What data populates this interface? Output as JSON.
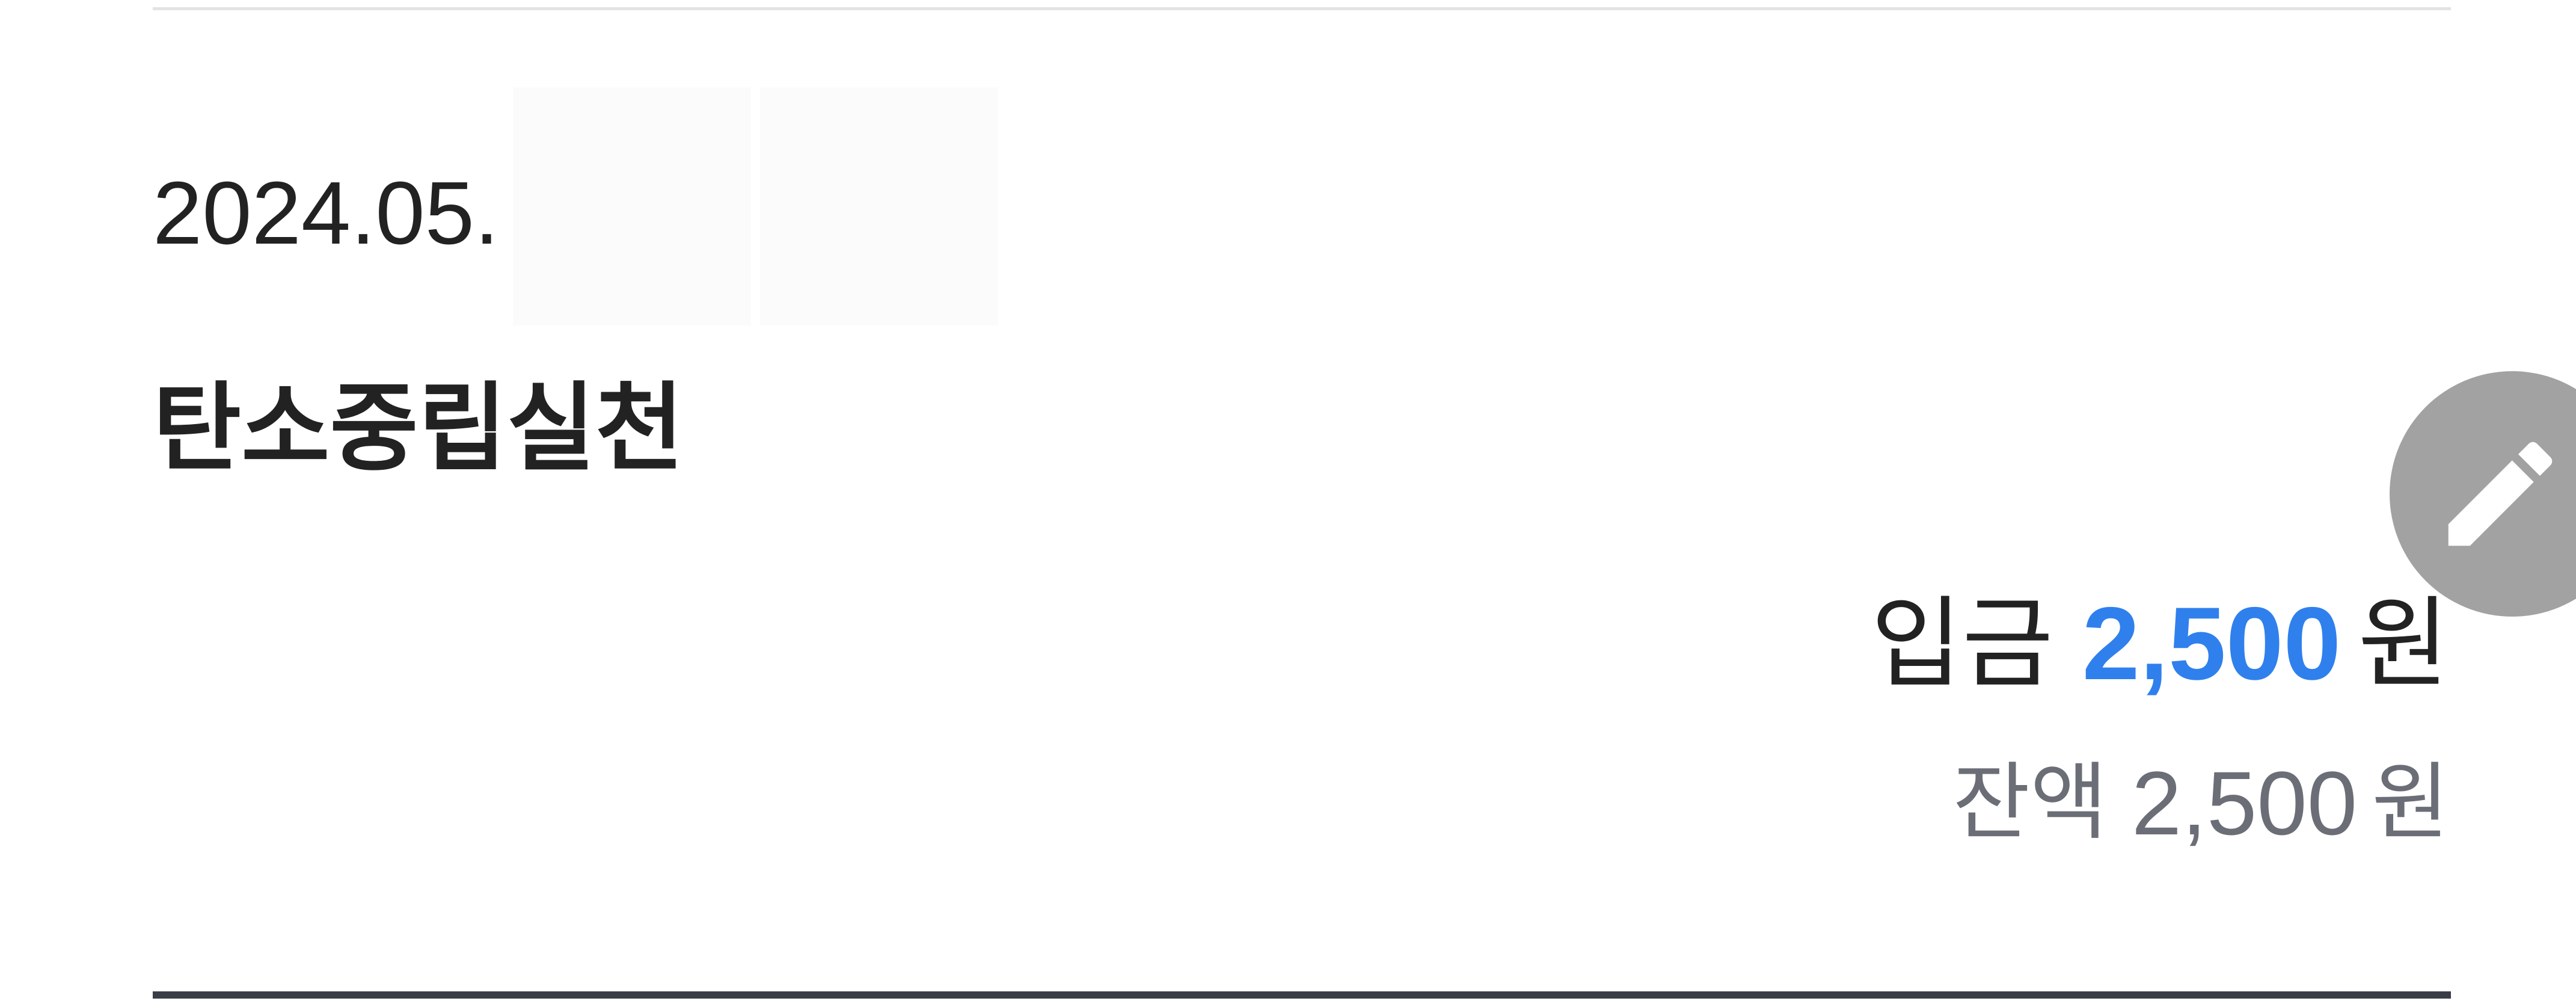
{
  "transaction": {
    "date": "2024.05.",
    "title": "탄소중립실천",
    "deposit_label": "입금",
    "deposit_amount": "2,500",
    "deposit_unit": "원",
    "balance_label": "잔액",
    "balance_amount": "2,500",
    "balance_unit": "원"
  },
  "fab": {
    "icon": "pencil-icon"
  },
  "colors": {
    "deposit_amount": "#2f80ed",
    "balance_text": "#6b6e76",
    "fab_background": "#a2a2a2",
    "bottom_divider": "#3a3d46"
  }
}
